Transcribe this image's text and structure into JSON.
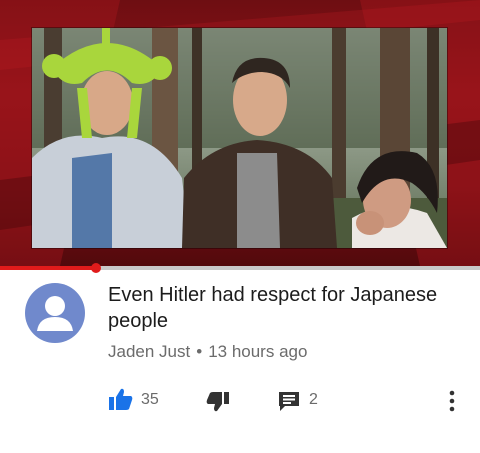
{
  "colors": {
    "accent_red": "#e01b1b",
    "like_blue": "#1a73e8",
    "avatar_bg": "#7089cc",
    "text_primary": "#1c1c1c",
    "text_secondary": "#6b6b6b"
  },
  "video": {
    "thumbnail_icon": "video-thumbnail",
    "progress_fraction": 0.2
  },
  "comment": {
    "avatar_icon": "default-avatar-icon",
    "text": "Even Hitler had respect for Japanese people",
    "author": "Jaden Just",
    "separator": "•",
    "time": "13 hours ago"
  },
  "actions": {
    "like_icon": "thumbs-up-icon",
    "like_count": "35",
    "dislike_icon": "thumbs-down-icon",
    "reply_icon": "reply-icon",
    "reply_count": "2",
    "more_icon": "more-vertical-icon"
  }
}
